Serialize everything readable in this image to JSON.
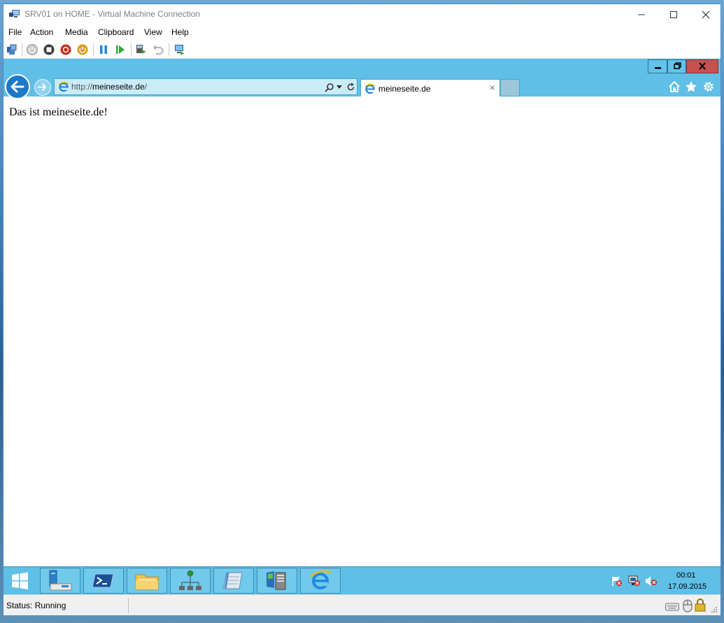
{
  "window": {
    "title": "SRV01 on HOME - Virtual Machine Connection"
  },
  "menu": [
    "File",
    "Action",
    "Media",
    "Clipboard",
    "View",
    "Help"
  ],
  "browser": {
    "address_prefix": "http://",
    "address_host": "meineseite.de",
    "address_suffix": "/",
    "tab_title": "meineseite.de",
    "tab_close": "×",
    "page_text": "Das ist meineseite.de!"
  },
  "taskbar": {
    "time": "00:01",
    "date": "17.09.2015"
  },
  "status": {
    "text": "Status: Running"
  },
  "colors": {
    "guest_frame": "#5fbfe6",
    "close_red": "#c75050",
    "back_button": "#1e78c8"
  }
}
